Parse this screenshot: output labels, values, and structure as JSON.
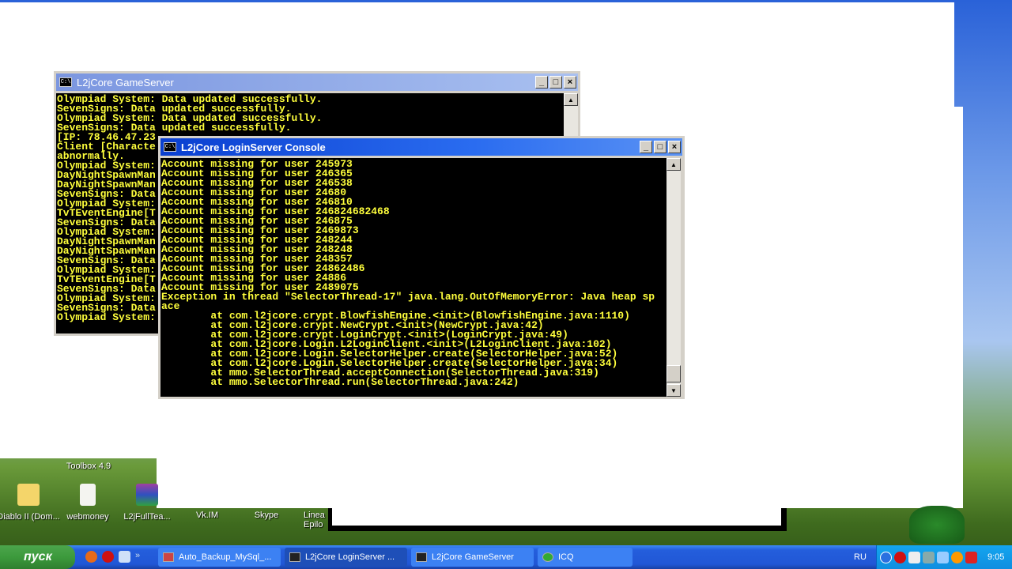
{
  "desktop": {
    "icons": [
      {
        "label": "Toolbox 4.9"
      },
      {
        "label": "Diablo II (Dom..."
      },
      {
        "label": "webmoney"
      },
      {
        "label": "L2jFullTea..."
      },
      {
        "label": "Vk.IM"
      },
      {
        "label": "Skype"
      },
      {
        "label": "Linea Epilo"
      }
    ]
  },
  "gameserver": {
    "title": "L2jCore GameServer",
    "lines": [
      "Olympiad System: Data updated successfully.",
      "SevenSigns: Data updated successfully.",
      "Olympiad System: Data updated successfully.",
      "SevenSigns: Data updated successfully.",
      "[IP: 78.46.47.23",
      "Client [Characte",
      "abnormally.",
      "Olympiad System:",
      "DayNightSpawnMan",
      "DayNightSpawnMan",
      "SevenSigns: Data",
      "Olympiad System:",
      "TvTEventEngine[T",
      "SevenSigns: Data",
      "Olympiad System:",
      "DayNightSpawnMan",
      "DayNightSpawnMan",
      "SevenSigns: Data",
      "Olympiad System:",
      "TvTEventEngine[T",
      "SevenSigns: Data",
      "Olympiad System:",
      "SevenSigns: Data",
      "Olympiad System:"
    ]
  },
  "loginserver": {
    "title": "L2jCore LoginServer Console",
    "lines": [
      "Account missing for user 245973",
      "Account missing for user 246365",
      "Account missing for user 246538",
      "Account missing for user 24680",
      "Account missing for user 246810",
      "Account missing for user 246824682468",
      "Account missing for user 246875",
      "Account missing for user 2469873",
      "Account missing for user 248244",
      "Account missing for user 248248",
      "Account missing for user 248357",
      "Account missing for user 24862486",
      "Account missing for user 24886",
      "Account missing for user 2489075",
      "Exception in thread \"SelectorThread-17\" java.lang.OutOfMemoryError: Java heap sp",
      "ace",
      "        at com.l2jcore.crypt.BlowfishEngine.<init>(BlowfishEngine.java:1110)",
      "        at com.l2jcore.crypt.NewCrypt.<init>(NewCrypt.java:42)",
      "        at com.l2jcore.crypt.LoginCrypt.<init>(LoginCrypt.java:49)",
      "        at com.l2jcore.Login.L2LoginClient.<init>(L2LoginClient.java:102)",
      "        at com.l2jcore.Login.SelectorHelper.create(SelectorHelper.java:52)",
      "        at com.l2jcore.Login.SelectorHelper.create(SelectorHelper.java:34)",
      "        at mmo.SelectorThread.acceptConnection(SelectorThread.java:319)",
      "        at mmo.SelectorThread.run(SelectorThread.java:242)"
    ]
  },
  "taskbar": {
    "start": "пуск",
    "more": "»",
    "tasks": [
      {
        "label": "Auto_Backup_MySql_..."
      },
      {
        "label": "L2jCore LoginServer ..."
      },
      {
        "label": "L2jCore GameServer"
      },
      {
        "label": "ICQ"
      }
    ],
    "lang": "RU",
    "clock": "9:05"
  }
}
